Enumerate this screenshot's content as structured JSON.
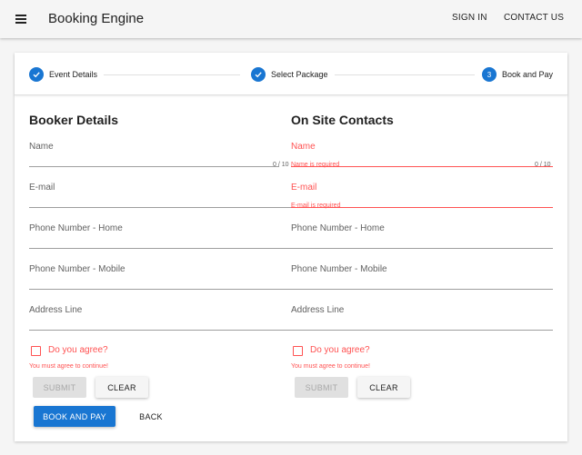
{
  "app": {
    "title": "Booking Engine",
    "nav": {
      "sign_in": "SIGN IN",
      "contact_us": "CONTACT US"
    }
  },
  "stepper": {
    "steps": [
      {
        "label": "Event Details",
        "state": "complete",
        "icon": "check-icon"
      },
      {
        "label": "Select Package",
        "state": "complete",
        "icon": "check-icon"
      },
      {
        "label": "Book and Pay",
        "state": "active",
        "number": "3"
      }
    ]
  },
  "booker": {
    "title": "Booker Details",
    "fields": {
      "name": {
        "label": "Name",
        "value": "",
        "counter": "0 / 10"
      },
      "email": {
        "label": "E-mail",
        "value": ""
      },
      "phone_home": {
        "label": "Phone Number - Home",
        "value": ""
      },
      "phone_mobile": {
        "label": "Phone Number - Mobile",
        "value": ""
      },
      "address": {
        "label": "Address Line",
        "value": ""
      }
    },
    "agree": {
      "label": "Do you agree?",
      "error": "You must agree to continue!",
      "checked": false
    },
    "submit": "SUBMIT",
    "clear": "CLEAR"
  },
  "onsite": {
    "title": "On Site Contacts",
    "fields": {
      "name": {
        "label": "Name",
        "value": "",
        "error": "Name is required",
        "counter": "0 / 10"
      },
      "email": {
        "label": "E-mail",
        "value": "",
        "error": "E-mail is required"
      },
      "phone_home": {
        "label": "Phone Number - Home",
        "value": ""
      },
      "phone_mobile": {
        "label": "Phone Number - Mobile",
        "value": ""
      },
      "address": {
        "label": "Address Line",
        "value": ""
      }
    },
    "agree": {
      "label": "Do you agree?",
      "error": "You must agree to continue!",
      "checked": false
    },
    "submit": "SUBMIT",
    "clear": "CLEAR"
  },
  "actions": {
    "book_and_pay": "BOOK AND PAY",
    "back": "BACK"
  },
  "colors": {
    "primary": "#1976d2",
    "error": "#ff5252",
    "background": "#f5f5f5"
  }
}
